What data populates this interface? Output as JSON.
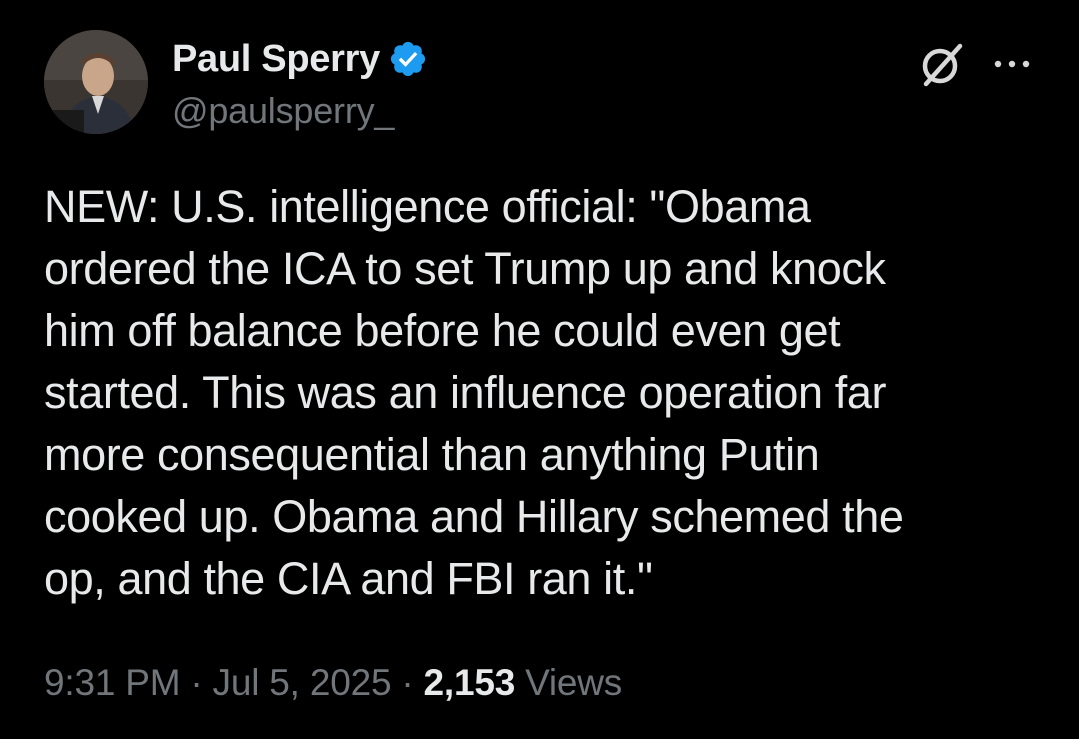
{
  "author": {
    "display_name": "Paul Sperry",
    "handle": "@paulsperry_",
    "verified": true,
    "verified_color": "#1d9bf0"
  },
  "actions": {
    "grok_icon": "grok-icon",
    "more_icon": "more-icon",
    "more_label": "···"
  },
  "tweet": {
    "text": "NEW: U.S. intelligence official: \"Obama\nordered the ICA to set Trump up and knock\nhim off balance before he could even get\nstarted. This was an influence operation far\nmore consequential than anything Putin\ncooked up. Obama and Hillary schemed the\nop, and the CIA and FBI ran it.\""
  },
  "meta": {
    "time": "9:31 PM",
    "separator": "·",
    "date": "Jul 5, 2025",
    "views_count": "2,153",
    "views_label": "Views"
  },
  "colors": {
    "background": "#000000",
    "primary_text": "#e7e9ea",
    "secondary_text": "#71767b",
    "accent": "#1d9bf0"
  }
}
